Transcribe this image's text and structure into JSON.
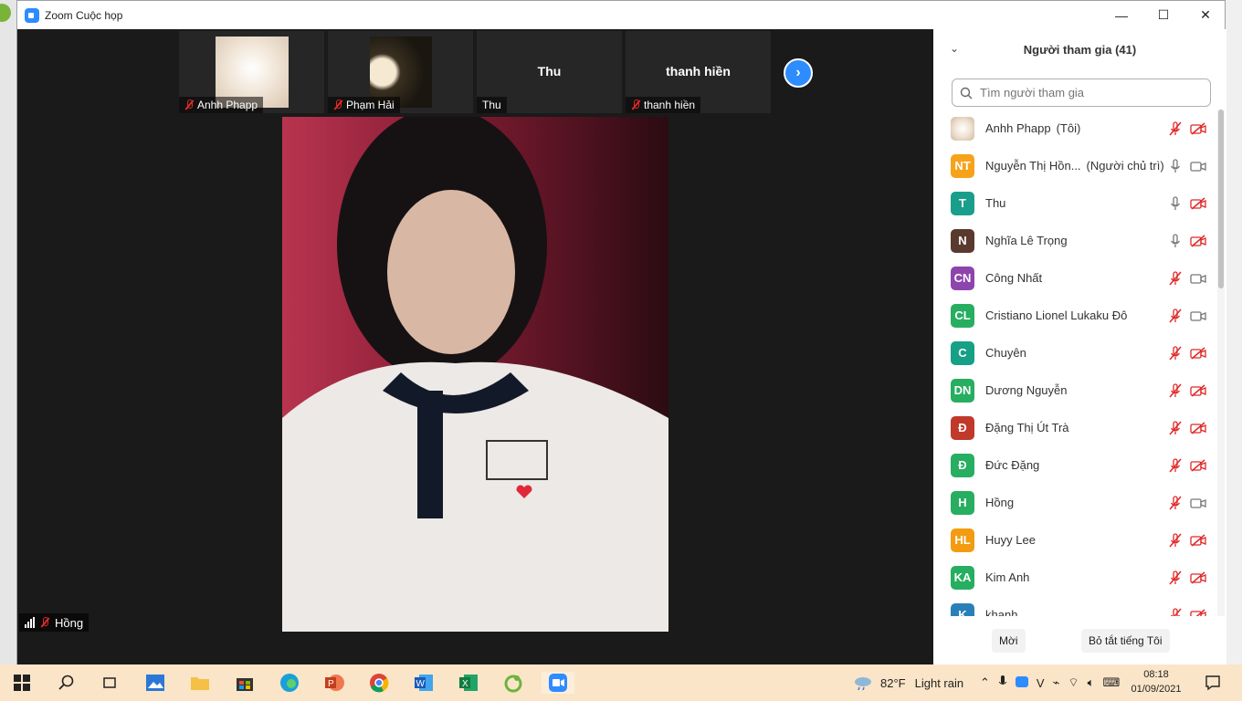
{
  "window": {
    "title": "Zoom Cuộc họp",
    "controls": {
      "minimize": "—",
      "maximize": "☐",
      "close": "✕"
    }
  },
  "thumbnails": [
    {
      "name": "Anhh Phapp",
      "muted": true,
      "has_video": true
    },
    {
      "name": "Phạm Hải",
      "muted": true,
      "has_video": true
    },
    {
      "name": "Thu",
      "muted": false,
      "has_video": false
    },
    {
      "name": "thanh hiền",
      "muted": true,
      "has_video": false
    }
  ],
  "next_icon": "chevron-right-icon",
  "main_speaker": {
    "name": "Hồng",
    "muted": true
  },
  "panel": {
    "title": "Người tham gia (41)",
    "search_placeholder": "Tìm người tham gia",
    "participants": [
      {
        "name": "Anhh Phapp",
        "role": "(Tôi)",
        "initials": "",
        "color": "#e8d9c8",
        "mic": "muted",
        "cam": "off"
      },
      {
        "name": "Nguyễn Thị Hồn...",
        "role": "(Người chủ trì)",
        "initials": "NT",
        "color": "#f7a21b",
        "mic": "on",
        "cam": "on"
      },
      {
        "name": "Thu",
        "role": "",
        "initials": "T",
        "color": "#1a9e8c",
        "mic": "on",
        "cam": "off"
      },
      {
        "name": "Nghĩa Lê Trọng",
        "role": "",
        "initials": "N",
        "color": "#5a3a2e",
        "mic": "on",
        "cam": "off"
      },
      {
        "name": "Công Nhất",
        "role": "",
        "initials": "CN",
        "color": "#8e44ad",
        "mic": "muted",
        "cam": "on"
      },
      {
        "name": "Cristiano Lionel Lukaku Đô",
        "role": "",
        "initials": "CL",
        "color": "#27ae60",
        "mic": "muted",
        "cam": "on"
      },
      {
        "name": "Chuyên",
        "role": "",
        "initials": "C",
        "color": "#16a085",
        "mic": "muted",
        "cam": "off"
      },
      {
        "name": "Dương Nguyễn",
        "role": "",
        "initials": "DN",
        "color": "#27ae60",
        "mic": "muted",
        "cam": "off"
      },
      {
        "name": "Đặng Thị Út Trà",
        "role": "",
        "initials": "Đ",
        "color": "#c0392b",
        "mic": "muted",
        "cam": "off"
      },
      {
        "name": "Đức Đặng",
        "role": "",
        "initials": "Đ",
        "color": "#27ae60",
        "mic": "muted",
        "cam": "off"
      },
      {
        "name": "Hồng",
        "role": "",
        "initials": "H",
        "color": "#27ae60",
        "mic": "muted",
        "cam": "on"
      },
      {
        "name": "Huyy Lee",
        "role": "",
        "initials": "HL",
        "color": "#f39c12",
        "mic": "muted",
        "cam": "off"
      },
      {
        "name": "Kim Anh",
        "role": "",
        "initials": "KA",
        "color": "#27ae60",
        "mic": "muted",
        "cam": "off"
      },
      {
        "name": "khanh",
        "role": "",
        "initials": "K",
        "color": "#2980b9",
        "mic": "muted",
        "cam": "off"
      }
    ],
    "invite_label": "Mời",
    "mute_all_label": "Bỏ tắt tiếng Tôi"
  },
  "taskbar": {
    "weather_temp": "82°F",
    "weather_desc": "Light rain",
    "time": "08:18",
    "date": "01/09/2021",
    "apps": [
      "windows-start-icon",
      "search-icon",
      "task-view-icon",
      "photos-icon",
      "file-explorer-icon",
      "store-icon",
      "edge-icon",
      "powerpoint-icon",
      "chrome-icon",
      "word-icon",
      "excel-icon",
      "app-icon",
      "zoom-icon"
    ]
  }
}
